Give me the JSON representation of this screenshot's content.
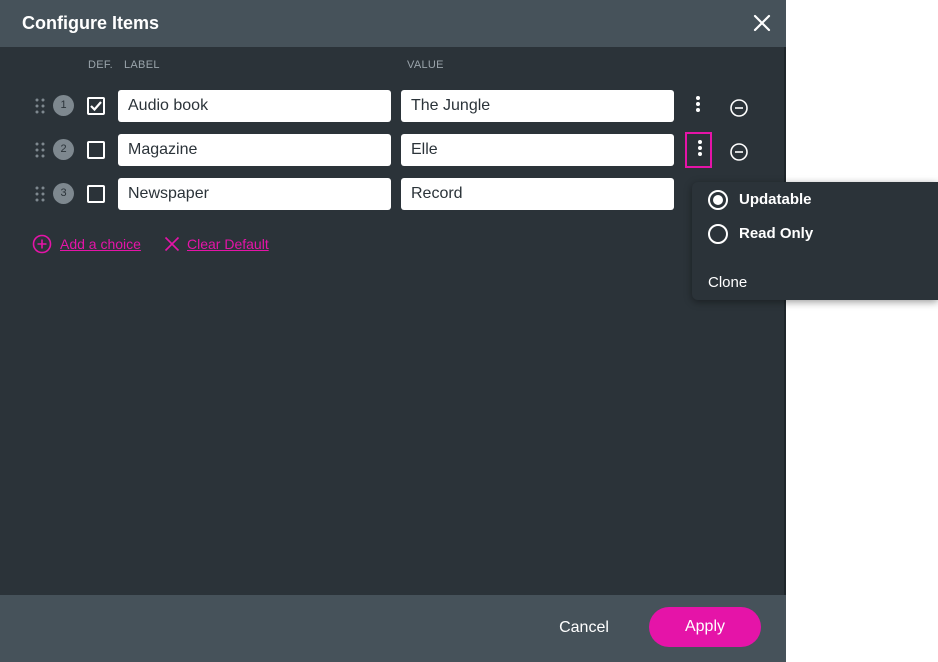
{
  "dialog": {
    "title": "Configure Items"
  },
  "columns": {
    "def": "DEF.",
    "label": "LABEL",
    "value": "VALUE"
  },
  "rows": [
    {
      "num": "1",
      "label": "Audio book",
      "value": "The Jungle",
      "checked": true
    },
    {
      "num": "2",
      "label": "Magazine",
      "value": "Elle",
      "checked": false
    },
    {
      "num": "3",
      "label": "Newspaper",
      "value": "Record",
      "checked": false
    }
  ],
  "actions": {
    "add_choice": "Add a choice",
    "clear_default": "Clear Default"
  },
  "menu": {
    "updatable": "Updatable",
    "read_only": "Read Only",
    "clone": "Clone",
    "selected": "Updatable"
  },
  "footer": {
    "cancel": "Cancel",
    "apply": "Apply"
  },
  "colors": {
    "accent": "#e514a8",
    "panel": "#2b3339",
    "header": "#46525a"
  }
}
